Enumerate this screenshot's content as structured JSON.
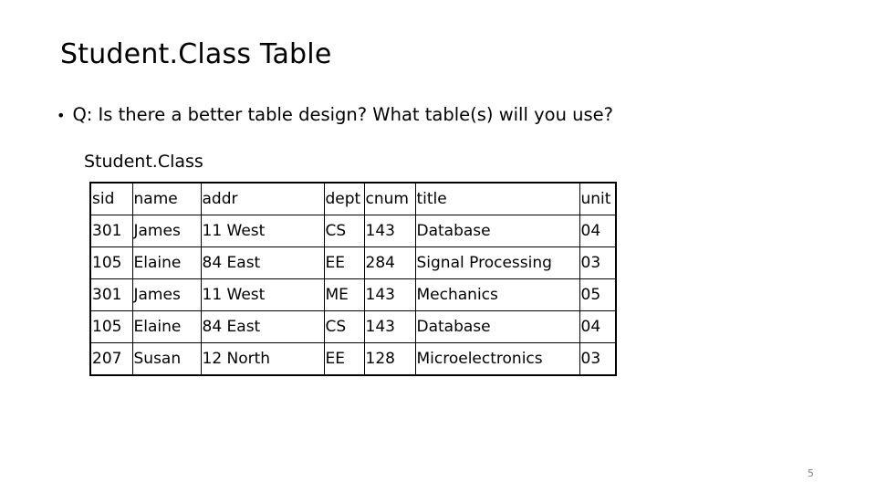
{
  "slide": {
    "title": "Student.Class Table",
    "bullet_marker": "•",
    "bullet_text": "Q: Is there a better table design? What table(s) will you use?",
    "table_caption": "Student.Class",
    "page_number": "5",
    "colors": {
      "text": "#000000",
      "background": "#ffffff",
      "table_border": "#000000",
      "page_number": "#808080"
    }
  },
  "table": {
    "columns": [
      "sid",
      "name",
      "addr",
      "dept",
      "cnum",
      "title",
      "unit"
    ],
    "rows": [
      [
        "301",
        "James",
        "11 West",
        "CS",
        "143",
        "Database",
        "04"
      ],
      [
        "105",
        "Elaine",
        "84 East",
        "EE",
        "284",
        "Signal Processing",
        "03"
      ],
      [
        "301",
        "James",
        "11 West",
        "ME",
        "143",
        "Mechanics",
        "05"
      ],
      [
        "105",
        "Elaine",
        "84 East",
        "CS",
        "143",
        "Database",
        "04"
      ],
      [
        "207",
        "Susan",
        "12 North",
        "EE",
        "128",
        "Microelectronics",
        "03"
      ]
    ]
  }
}
